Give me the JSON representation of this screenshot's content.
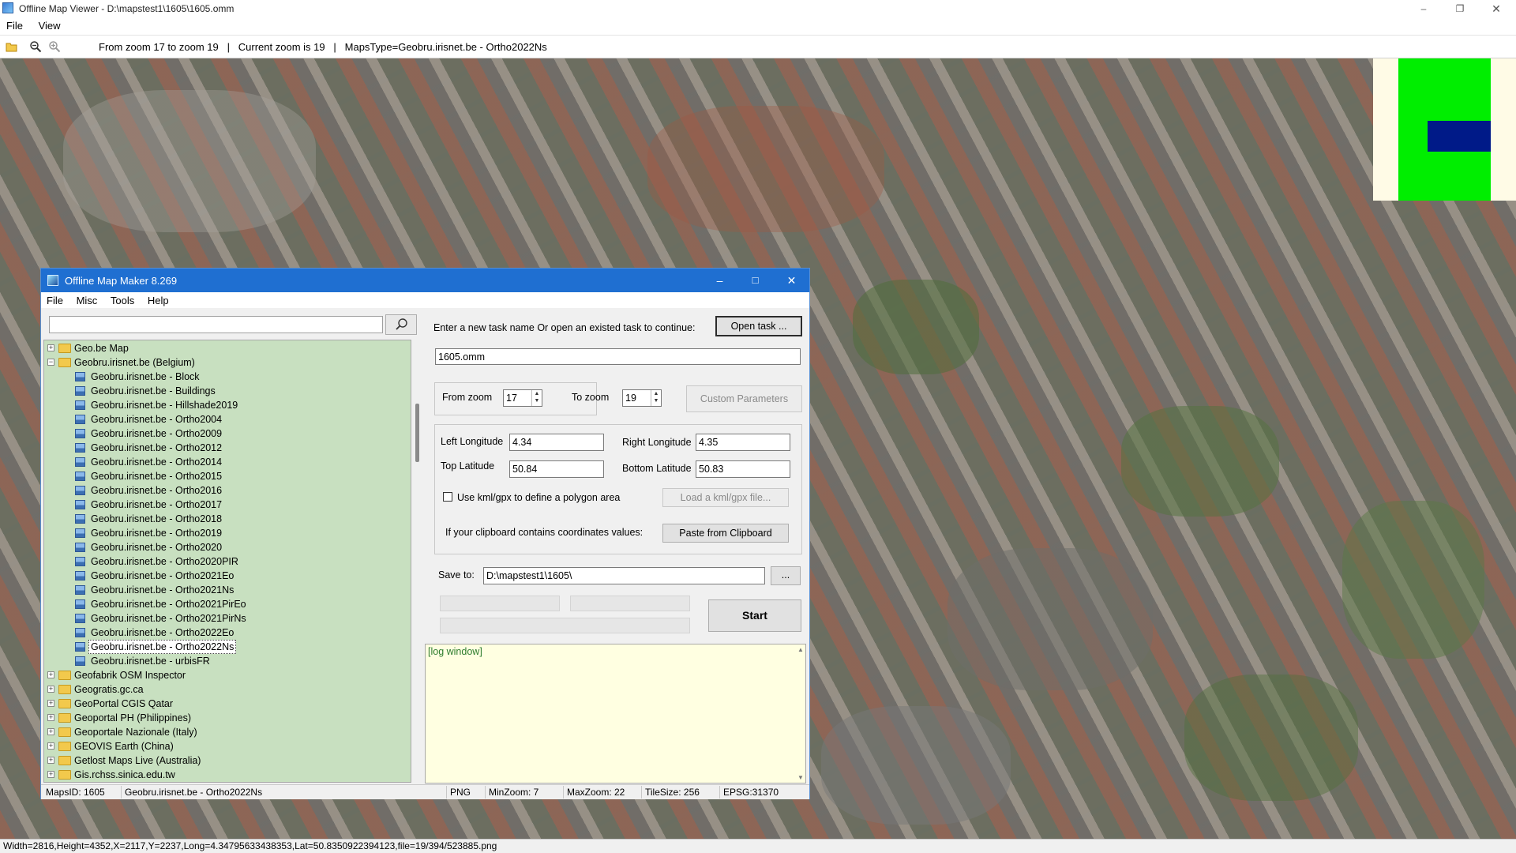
{
  "window": {
    "title": "Offline Map Viewer - D:\\mapstest1\\1605\\1605.omm"
  },
  "menu": [
    "File",
    "View"
  ],
  "toolbar": {
    "info": "From zoom 17 to zoom 19   |   Current zoom is 19   |   MapsType=Geobru.irisnet.be - Ortho2022Ns",
    "icons": [
      "folder-open-icon",
      "zoom-out-icon",
      "zoom-in-icon"
    ]
  },
  "statusbar": {
    "text": "Width=2816,Height=4352,X=2117,Y=2237,Long=4.34795633438353,Lat=50.8350922394123,file=19/394/523885.png"
  },
  "minimap": {
    "colors": {
      "background": "#fffbe6",
      "area": "#00ee00",
      "viewport": "#001a88"
    }
  },
  "dialog": {
    "title": "Offline Map Maker 8.269",
    "menu": [
      "File",
      "Misc",
      "Tools",
      "Help"
    ],
    "search": {
      "value": ""
    },
    "tree": [
      {
        "label": "Geo.be Map",
        "type": "folder",
        "expanded": false,
        "level": 0
      },
      {
        "label": "Geobru.irisnet.be (Belgium)",
        "type": "folder",
        "expanded": true,
        "level": 0
      },
      {
        "label": "Geobru.irisnet.be - Block",
        "type": "map",
        "level": 1
      },
      {
        "label": "Geobru.irisnet.be - Buildings",
        "type": "map",
        "level": 1
      },
      {
        "label": "Geobru.irisnet.be - Hillshade2019",
        "type": "map",
        "level": 1
      },
      {
        "label": "Geobru.irisnet.be - Ortho2004",
        "type": "map",
        "level": 1
      },
      {
        "label": "Geobru.irisnet.be - Ortho2009",
        "type": "map",
        "level": 1
      },
      {
        "label": "Geobru.irisnet.be - Ortho2012",
        "type": "map",
        "level": 1
      },
      {
        "label": "Geobru.irisnet.be - Ortho2014",
        "type": "map",
        "level": 1
      },
      {
        "label": "Geobru.irisnet.be - Ortho2015",
        "type": "map",
        "level": 1
      },
      {
        "label": "Geobru.irisnet.be - Ortho2016",
        "type": "map",
        "level": 1
      },
      {
        "label": "Geobru.irisnet.be - Ortho2017",
        "type": "map",
        "level": 1
      },
      {
        "label": "Geobru.irisnet.be - Ortho2018",
        "type": "map",
        "level": 1
      },
      {
        "label": "Geobru.irisnet.be - Ortho2019",
        "type": "map",
        "level": 1
      },
      {
        "label": "Geobru.irisnet.be - Ortho2020",
        "type": "map",
        "level": 1
      },
      {
        "label": "Geobru.irisnet.be - Ortho2020PIR",
        "type": "map",
        "level": 1
      },
      {
        "label": "Geobru.irisnet.be - Ortho2021Eo",
        "type": "map",
        "level": 1
      },
      {
        "label": "Geobru.irisnet.be - Ortho2021Ns",
        "type": "map",
        "level": 1
      },
      {
        "label": "Geobru.irisnet.be - Ortho2021PirEo",
        "type": "map",
        "level": 1
      },
      {
        "label": "Geobru.irisnet.be - Ortho2021PirNs",
        "type": "map",
        "level": 1
      },
      {
        "label": "Geobru.irisnet.be - Ortho2022Eo",
        "type": "map",
        "level": 1
      },
      {
        "label": "Geobru.irisnet.be - Ortho2022Ns",
        "type": "map",
        "level": 1,
        "selected": true
      },
      {
        "label": "Geobru.irisnet.be - urbisFR",
        "type": "map",
        "level": 1
      },
      {
        "label": "Geofabrik OSM Inspector",
        "type": "folder",
        "expanded": false,
        "level": 0
      },
      {
        "label": "Geogratis.gc.ca",
        "type": "folder",
        "expanded": false,
        "level": 0
      },
      {
        "label": "GeoPortal CGIS Qatar",
        "type": "folder",
        "expanded": false,
        "level": 0
      },
      {
        "label": "Geoportal PH (Philippines)",
        "type": "folder",
        "expanded": false,
        "level": 0
      },
      {
        "label": "Geoportale Nazionale (Italy)",
        "type": "folder",
        "expanded": false,
        "level": 0
      },
      {
        "label": "GEOVIS Earth (China)",
        "type": "folder",
        "expanded": false,
        "level": 0
      },
      {
        "label": "Getlost Maps Live (Australia)",
        "type": "folder",
        "expanded": false,
        "level": 0
      },
      {
        "label": "Gis.rchss.sinica.edu.tw",
        "type": "folder",
        "expanded": false,
        "level": 0
      }
    ],
    "task": {
      "prompt": "Enter a new task name Or open an existed task to continue:",
      "open_button": "Open task ...",
      "name_value": "1605.omm"
    },
    "zoom": {
      "from_label": "From zoom",
      "from_value": "17",
      "to_label": "To zoom",
      "to_value": "19",
      "custom_button": "Custom Parameters"
    },
    "coords": {
      "left_lon_label": "Left Longitude",
      "left_lon_value": "4.34",
      "right_lon_label": "Right Longitude",
      "right_lon_value": "4.35",
      "top_lat_label": "Top Latitude",
      "top_lat_value": "50.84",
      "bottom_lat_label": "Bottom Latitude",
      "bottom_lat_value": "50.83",
      "kml_checkbox_label": "Use kml/gpx to define a polygon area",
      "kml_checked": false,
      "load_kml_button": "Load a kml/gpx file...",
      "clipboard_label": "If your clipboard contains coordinates values:",
      "paste_button": "Paste from Clipboard"
    },
    "save": {
      "label": "Save to:",
      "value": "D:\\mapstest1\\1605\\",
      "browse_button": "...",
      "start_button": "Start"
    },
    "log": {
      "text": "[log window]"
    },
    "status": {
      "maps_id": "MapsID: 1605",
      "map_name": "Geobru.irisnet.be - Ortho2022Ns",
      "format": "PNG",
      "min_zoom": "MinZoom: 7",
      "max_zoom": "MaxZoom: 22",
      "tile_size": "TileSize: 256",
      "epsg": "EPSG:31370"
    }
  }
}
